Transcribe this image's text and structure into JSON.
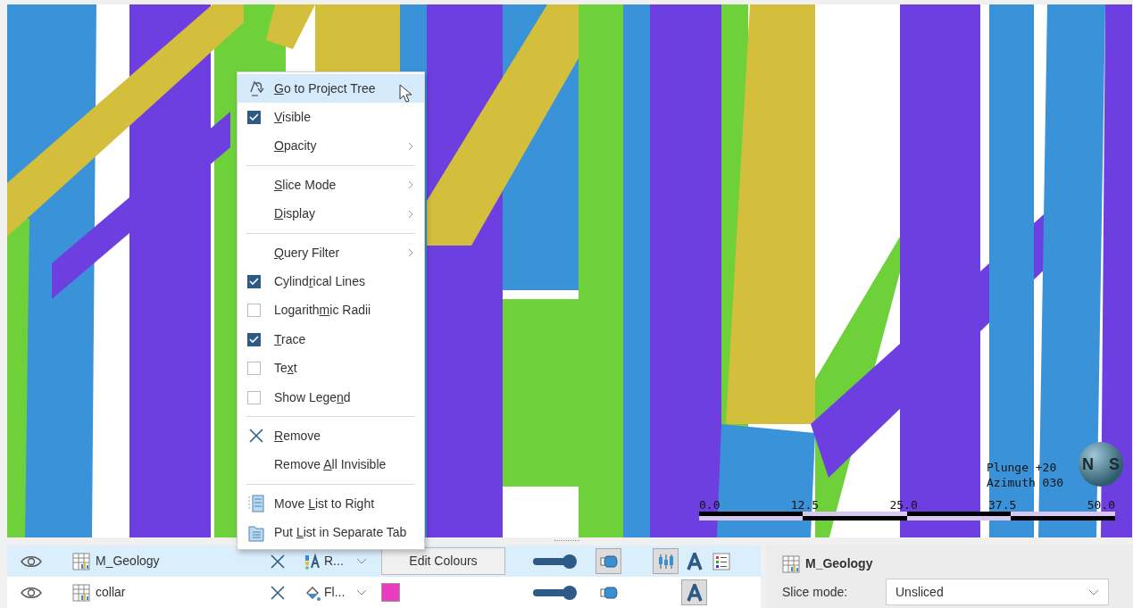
{
  "viewport": {
    "orientation": [
      "Plunge +20",
      "Azimuth 030"
    ],
    "compass_labels": [
      "N",
      "S"
    ],
    "scale_labels": [
      "0.0",
      "12.5",
      "25.0",
      "37.5",
      "50.0"
    ]
  },
  "context_menu": [
    {
      "kind": "tree",
      "label": {
        "key": "G",
        "after": "o to Project Tree"
      },
      "selected": true,
      "submenu": false
    },
    {
      "kind": "check",
      "checked": true,
      "label": {
        "key": "V",
        "after": "isible"
      },
      "selected": false,
      "submenu": false
    },
    {
      "kind": "plain",
      "label": {
        "key": "O",
        "after": "pacity"
      },
      "selected": false,
      "submenu": true
    },
    {
      "kind": "separator"
    },
    {
      "kind": "plain",
      "label": {
        "key": "S",
        "after": "lice Mode"
      },
      "selected": false,
      "submenu": true
    },
    {
      "kind": "plain",
      "label": {
        "key": "D",
        "after": "isplay"
      },
      "selected": false,
      "submenu": true
    },
    {
      "kind": "separator"
    },
    {
      "kind": "plain",
      "label": {
        "key": "Q",
        "after": "uery Filter"
      },
      "selected": false,
      "submenu": true
    },
    {
      "kind": "check",
      "checked": true,
      "label": {
        "before": "Cylind",
        "key": "r",
        "after": "ical Lines"
      },
      "selected": false,
      "submenu": false
    },
    {
      "kind": "check",
      "checked": false,
      "label": {
        "before": "Logarith",
        "key": "m",
        "after": "ic Radii"
      },
      "selected": false,
      "submenu": false
    },
    {
      "kind": "check",
      "checked": true,
      "label": {
        "key": "T",
        "after": "race"
      },
      "selected": false,
      "submenu": false
    },
    {
      "kind": "check",
      "checked": false,
      "label": {
        "before": "Te",
        "key": "x",
        "after": "t"
      },
      "selected": false,
      "submenu": false
    },
    {
      "kind": "check",
      "checked": false,
      "label": {
        "before": "Show Lege",
        "key": "n",
        "after": "d"
      },
      "selected": false,
      "submenu": false
    },
    {
      "kind": "separator"
    },
    {
      "kind": "remove",
      "label": {
        "key": "R",
        "after": "emove"
      },
      "selected": false,
      "submenu": false
    },
    {
      "kind": "plain",
      "label": {
        "before": "Remove ",
        "key": "A",
        "after": "ll Invisible"
      },
      "selected": false,
      "submenu": false
    },
    {
      "kind": "separator"
    },
    {
      "kind": "move",
      "label": {
        "before": "Move ",
        "key": "L",
        "after": "ist to Right"
      },
      "selected": false,
      "submenu": false
    },
    {
      "kind": "tab",
      "label": {
        "before": "Put ",
        "key": "L",
        "after": "ist in Separate Tab"
      },
      "selected": false,
      "submenu": false
    }
  ],
  "layers": [
    {
      "name": "M_Geology",
      "selected": true,
      "colour_mode": "R...",
      "colour": {
        "kind": "button",
        "label": "Edit Colours"
      },
      "opacity": {
        "level": 0.85
      },
      "cylinder_pressed": true,
      "extra_tool": true,
      "text_pressed": false,
      "legend": true
    },
    {
      "name": "collar",
      "selected": false,
      "colour_mode": "Fl...",
      "colour": {
        "kind": "swatch",
        "color": "#e93cc0"
      },
      "opacity": {
        "level": 0.85
      },
      "cylinder_pressed": false,
      "extra_tool": false,
      "text_pressed": true,
      "legend": false
    }
  ],
  "properties": {
    "title": "M_Geology",
    "slice_mode_label": "Slice mode:",
    "slice_mode_value": "Unsliced"
  }
}
